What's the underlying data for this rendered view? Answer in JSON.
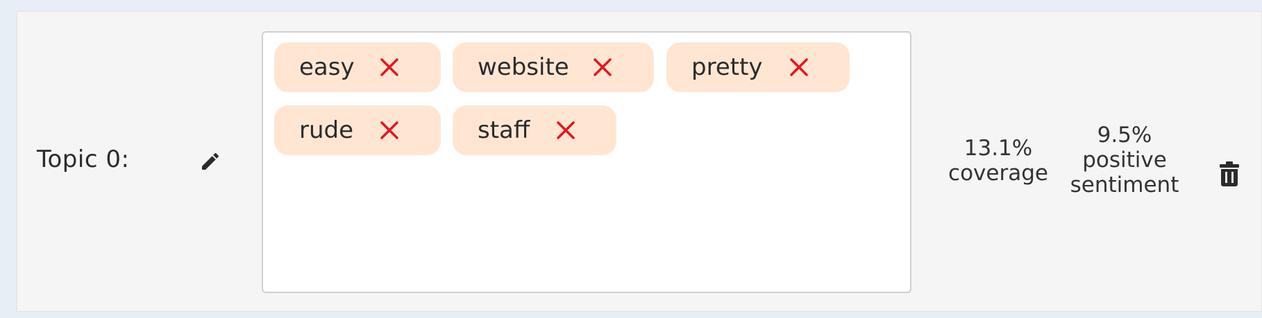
{
  "topic": {
    "label": "Topic 0:",
    "edit_icon": "pencil-icon",
    "delete_icon": "trash-icon"
  },
  "keywords": [
    {
      "label": "easy"
    },
    {
      "label": "website"
    },
    {
      "label": "pretty"
    },
    {
      "label": "rude"
    },
    {
      "label": "staff"
    }
  ],
  "stats": {
    "coverage_value": "13.1%",
    "coverage_label": "coverage",
    "sentiment_value": "9.5%",
    "sentiment_label_1": "positive",
    "sentiment_label_2": "sentiment"
  },
  "colors": {
    "chip_bg": "#ffe6d3",
    "remove_x": "#e8141b",
    "text": "#2b2b2b",
    "card_bg": "#f5f5f5",
    "page_bg": "#e8eef5"
  }
}
